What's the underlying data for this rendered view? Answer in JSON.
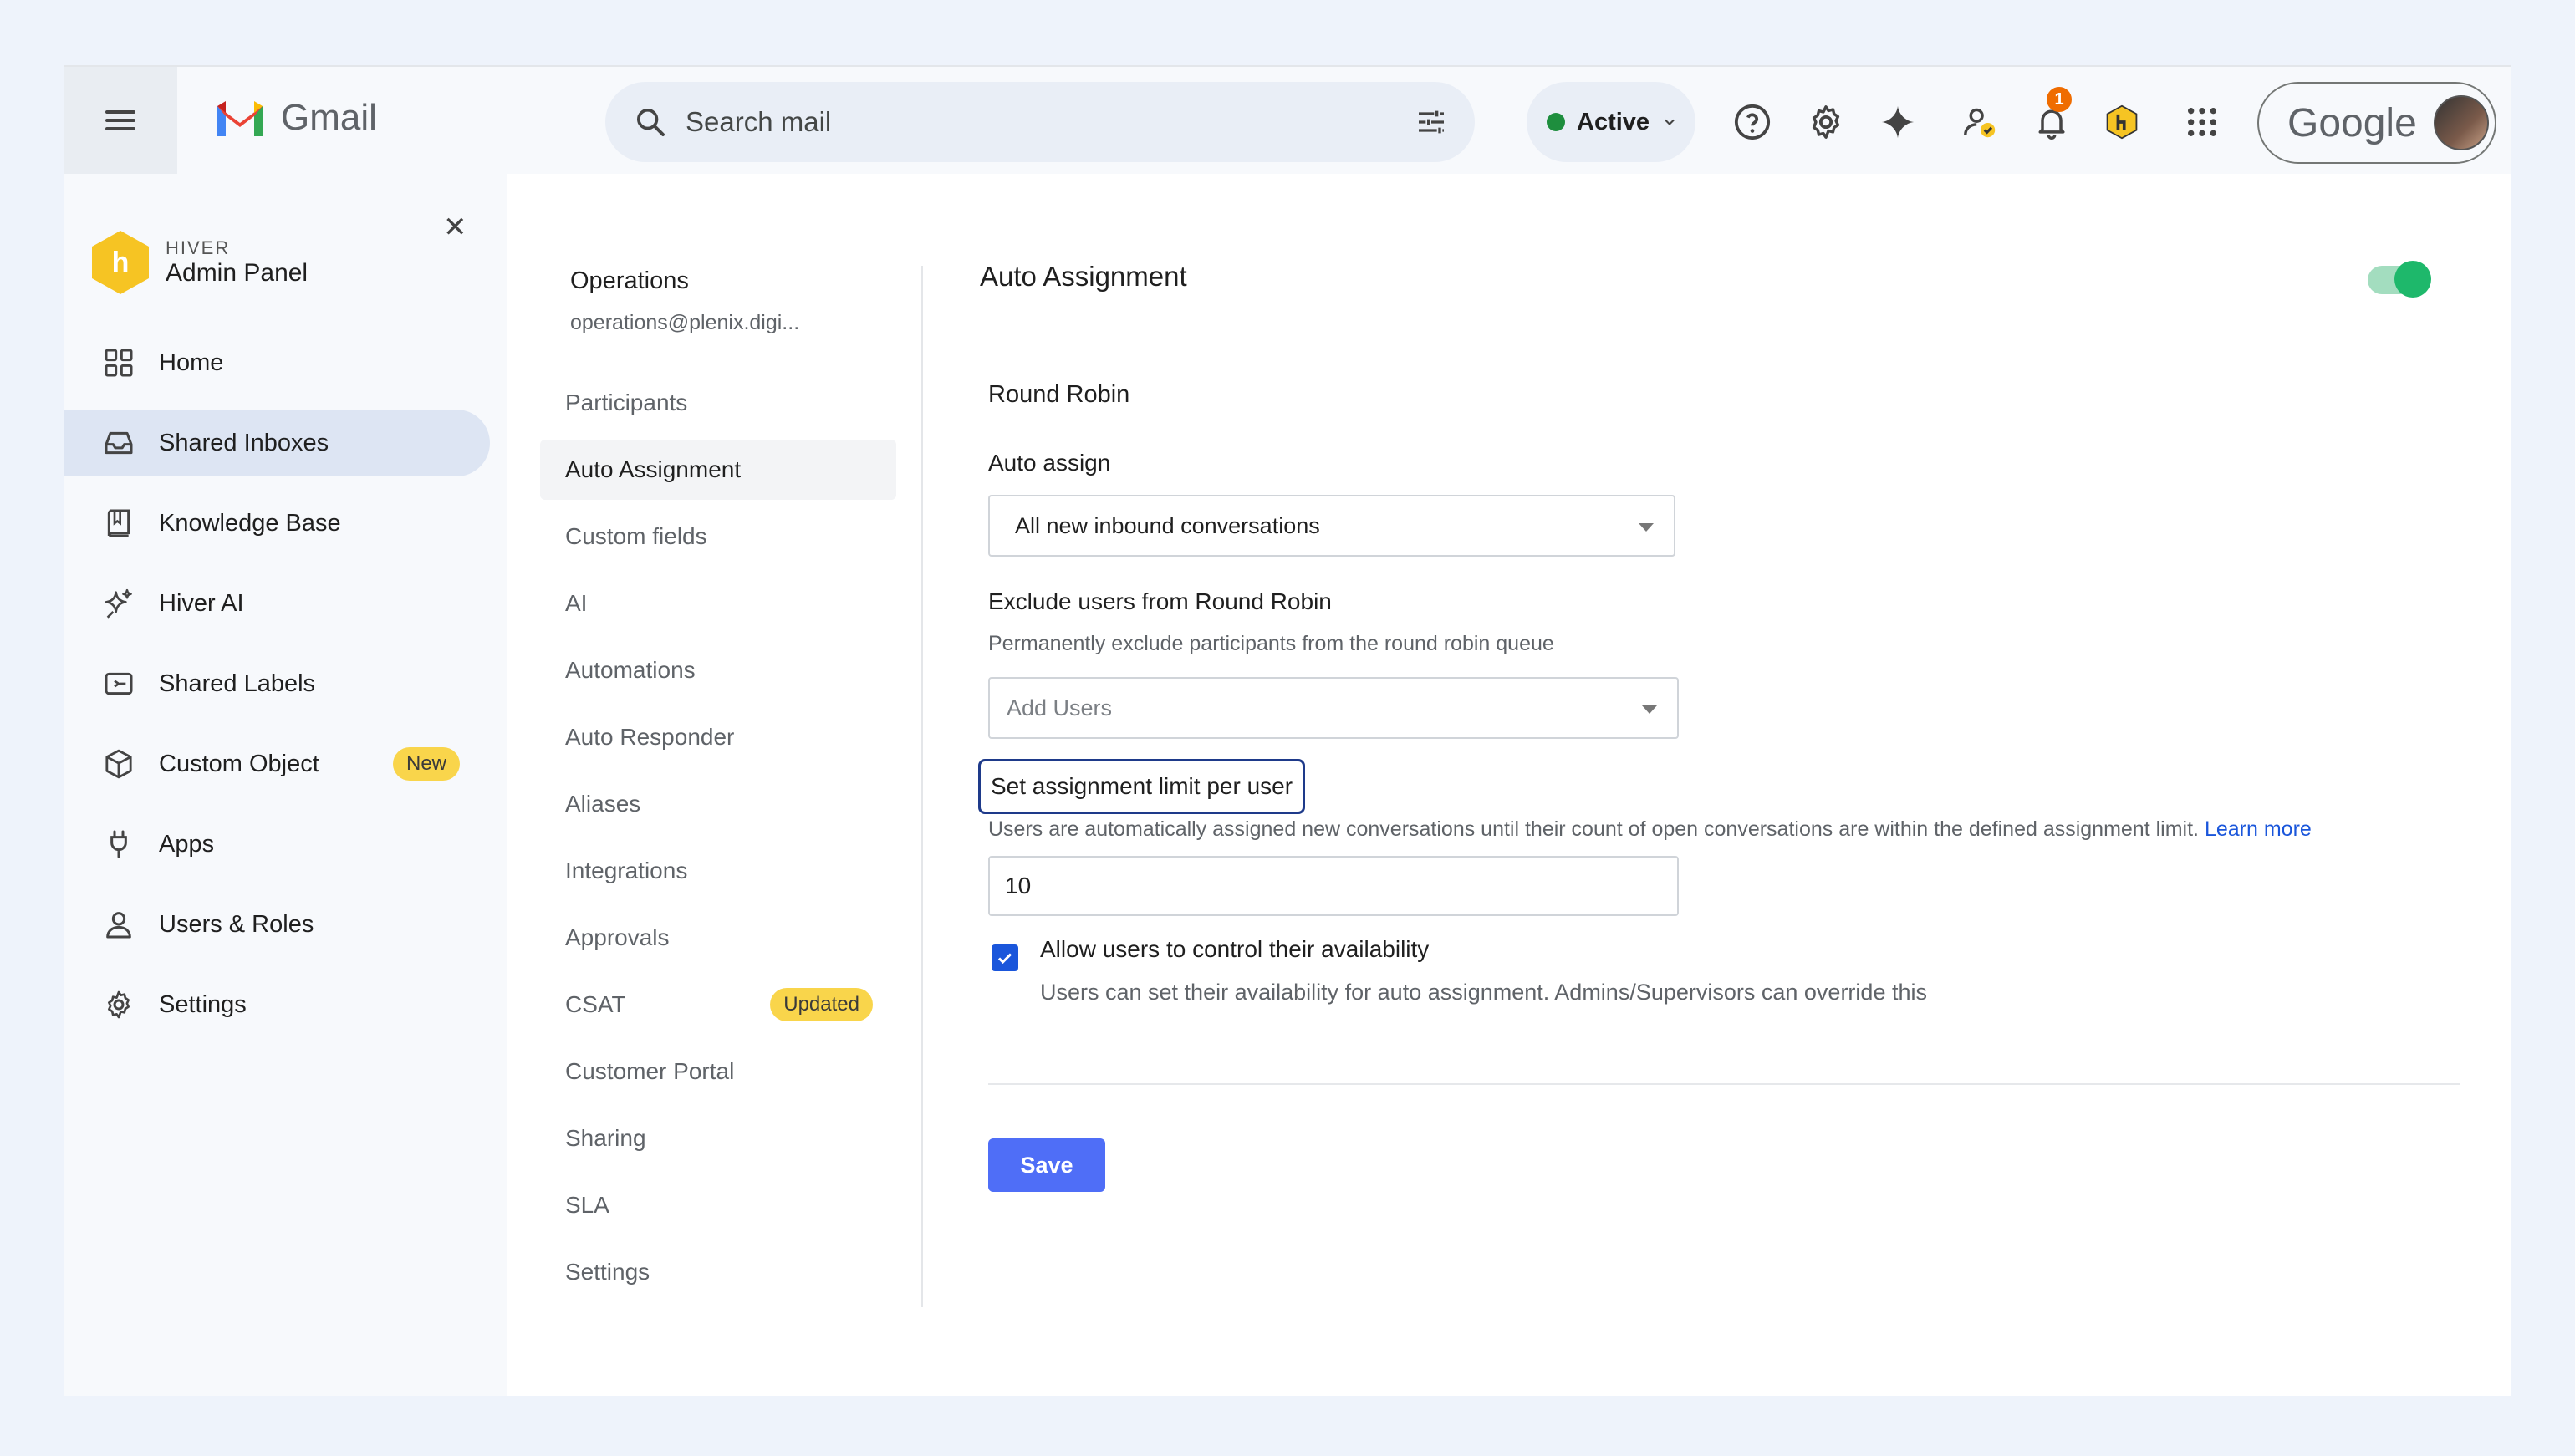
{
  "gmail": {
    "app_name": "Gmail",
    "search_placeholder": "Search mail",
    "status": "Active",
    "notification_count": "1",
    "account_label": "Google"
  },
  "admin": {
    "brand_small": "HIVER",
    "brand_title": "Admin Panel",
    "nav": [
      {
        "label": "Home",
        "icon": "grid-icon"
      },
      {
        "label": "Shared Inboxes",
        "icon": "inbox-icon"
      },
      {
        "label": "Knowledge Base",
        "icon": "book-icon"
      },
      {
        "label": "Hiver AI",
        "icon": "sparkle-icon"
      },
      {
        "label": "Shared Labels",
        "icon": "label-icon"
      },
      {
        "label": "Custom Object",
        "icon": "cube-icon",
        "badge": "New"
      },
      {
        "label": "Apps",
        "icon": "plug-icon"
      },
      {
        "label": "Users & Roles",
        "icon": "user-icon"
      },
      {
        "label": "Settings",
        "icon": "gear-icon"
      }
    ]
  },
  "inbox": {
    "name": "Operations",
    "email": "operations@plenix.digi...",
    "menu": [
      {
        "label": "Participants"
      },
      {
        "label": "Auto Assignment"
      },
      {
        "label": "Custom fields"
      },
      {
        "label": "AI"
      },
      {
        "label": "Automations"
      },
      {
        "label": "Auto Responder"
      },
      {
        "label": "Aliases"
      },
      {
        "label": "Integrations"
      },
      {
        "label": "Approvals"
      },
      {
        "label": "CSAT",
        "badge": "Updated"
      },
      {
        "label": "Customer Portal"
      },
      {
        "label": "Sharing"
      },
      {
        "label": "SLA"
      },
      {
        "label": "Settings"
      }
    ]
  },
  "auto_assignment": {
    "title": "Auto Assignment",
    "enabled": true,
    "method": "Round Robin",
    "auto_assign_label": "Auto assign",
    "auto_assign_value": "All new inbound conversations",
    "exclude_label": "Exclude users from Round Robin",
    "exclude_hint": "Permanently exclude participants from the round robin queue",
    "exclude_placeholder": "Add Users",
    "limit_label": "Set assignment limit per user",
    "limit_hint": "Users are automatically assigned new conversations until their count of open conversations are within the defined assignment limit.",
    "learn_more": "Learn more",
    "limit_value": "10",
    "availability_label": "Allow users to control their availability",
    "availability_hint": "Users can set their availability for auto assignment. Admins/Supervisors can override this",
    "availability_checked": true,
    "save_label": "Save"
  },
  "colors": {
    "accent": "#4f6ef7",
    "toggle_on": "#1eb86b",
    "badge_yellow": "#f9d54b",
    "active_status": "#1e8e3e"
  }
}
